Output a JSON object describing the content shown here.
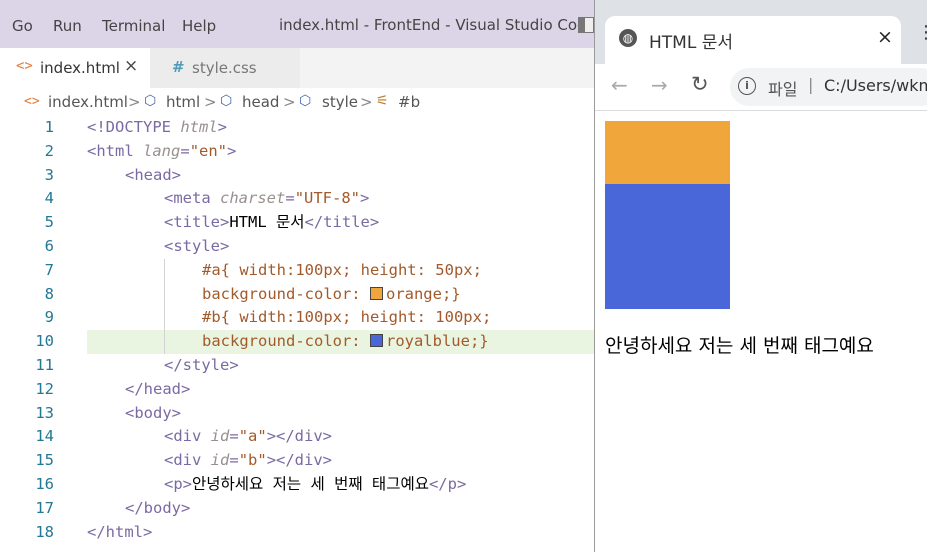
{
  "menu": [
    "Go",
    "Run",
    "Terminal",
    "Help"
  ],
  "window_title": "index.html - FrontEnd - Visual Studio Code",
  "tabs": [
    {
      "label": "index.html",
      "icon": "html-brackets-icon",
      "active": true,
      "close": "×"
    },
    {
      "label": "style.css",
      "icon": "css-hash-icon",
      "active": false
    }
  ],
  "breadcrumb": {
    "file": "index.html",
    "items": [
      "html",
      "head",
      "style"
    ],
    "symbol": "#b",
    "sep": ">"
  },
  "editor": {
    "active_line": 10,
    "line_numbers": [
      "1",
      "2",
      "3",
      "4",
      "5",
      "6",
      "7",
      "8",
      "9",
      "10",
      "11",
      "12",
      "13",
      "14",
      "15",
      "16",
      "17",
      "18"
    ],
    "code": {
      "l1_doctype": "<!DOCTYPE",
      "l1_html": "html",
      "l1_end": ">",
      "l2_open": "<html",
      "l2_attr": "lang",
      "l2_eq": "=",
      "l2_val": "\"en\"",
      "l2_end": ">",
      "l3": "<head>",
      "l4_open": "<meta",
      "l4_attr": "charset",
      "l4_eq": "=",
      "l4_val": "\"UTF-8\"",
      "l4_end": ">",
      "l5_open": "<title>",
      "l5_text": "HTML 문서",
      "l5_close": "</title>",
      "l6": "<style>",
      "l7_sel": "#a{",
      "l7_rest": " width:100px; height: 50px;",
      "l8_prop": "background-color: ",
      "l8_val": "orange;}",
      "l9_sel": "#b{",
      "l9_rest": " width:100px; height: 100px;",
      "l10_prop": "background-color: ",
      "l10_val": "royalblue;}",
      "l11": "</style>",
      "l12": "</head>",
      "l13": "<body>",
      "l14_open": "<div",
      "l14_attr": "id",
      "l14_eq": "=",
      "l14_val": "\"a\"",
      "l14_end": "></div>",
      "l15_open": "<div",
      "l15_attr": "id",
      "l15_eq": "=",
      "l15_val": "\"b\"",
      "l15_end": "></div>",
      "l16_open": "<p>",
      "l16_text": "안녕하세요 저는 세 번째 태그예요",
      "l16_close": "</p>",
      "l17": "</body>",
      "l18": "</html>"
    },
    "swatches": {
      "orange": "#f0a63a",
      "royalblue": "#4a67d9"
    }
  },
  "browser": {
    "tab_title": "HTML 문서",
    "tab_close": "×",
    "omnibox": {
      "scheme": "파일",
      "pipe": "|",
      "url": "C:/Users/wkm"
    },
    "page": {
      "div_a_color": "#f0a63a",
      "div_b_color": "#4a67d9",
      "paragraph": "안녕하세요 저는 세 번째 태그예요"
    }
  }
}
